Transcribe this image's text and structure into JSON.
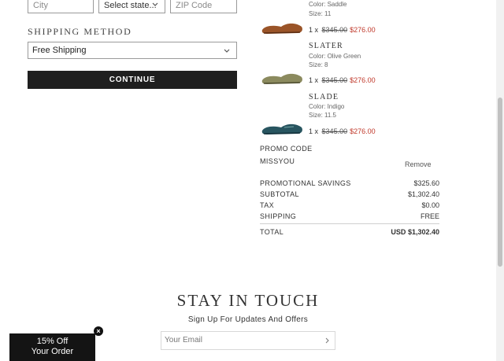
{
  "address": {
    "city_placeholder": "City",
    "state_selected": "Select state...",
    "zip_placeholder": "ZIP Code"
  },
  "shipping": {
    "title": "SHIPPING METHOD",
    "selected": "Free Shipping"
  },
  "continue_label": "CONTINUE",
  "items": [
    {
      "name": "",
      "color": "Color: Saddle",
      "size": "Size: 11",
      "qty": "1",
      "x": "x",
      "old_price": "$345.00",
      "new_price": "$276.00",
      "shoe_color": "#9a5428"
    },
    {
      "name": "SLATER",
      "color": "Color: Olive Green",
      "size": "Size: 8",
      "qty": "1",
      "x": "x",
      "old_price": "$345.00",
      "new_price": "$276.00",
      "shoe_color": "#8b8a5e"
    },
    {
      "name": "SLADE",
      "color": "Color: Indigo",
      "size": "Size: 11.5",
      "qty": "1",
      "x": "x",
      "old_price": "$345.00",
      "new_price": "$276.00",
      "shoe_color": "#285560"
    }
  ],
  "promo": {
    "label": "PROMO CODE",
    "code": "MISSYOU",
    "remove": "Remove"
  },
  "summary": {
    "savings_label": "PROMOTIONAL SAVINGS",
    "savings": "$325.60",
    "subtotal_label": "SUBTOTAL",
    "subtotal": "$1,302.40",
    "tax_label": "TAX",
    "tax": "$0.00",
    "shipping_label": "SHIPPING",
    "shipping": "FREE",
    "total_label": "TOTAL",
    "currency": "USD",
    "total": "$1,302.40"
  },
  "newsletter": {
    "title": "STAY IN TOUCH",
    "subtitle": "Sign Up For Updates And Offers",
    "email_placeholder": "Your Email"
  },
  "popup": {
    "line1": "15% Off",
    "line2": "Your Order",
    "close": "×"
  }
}
